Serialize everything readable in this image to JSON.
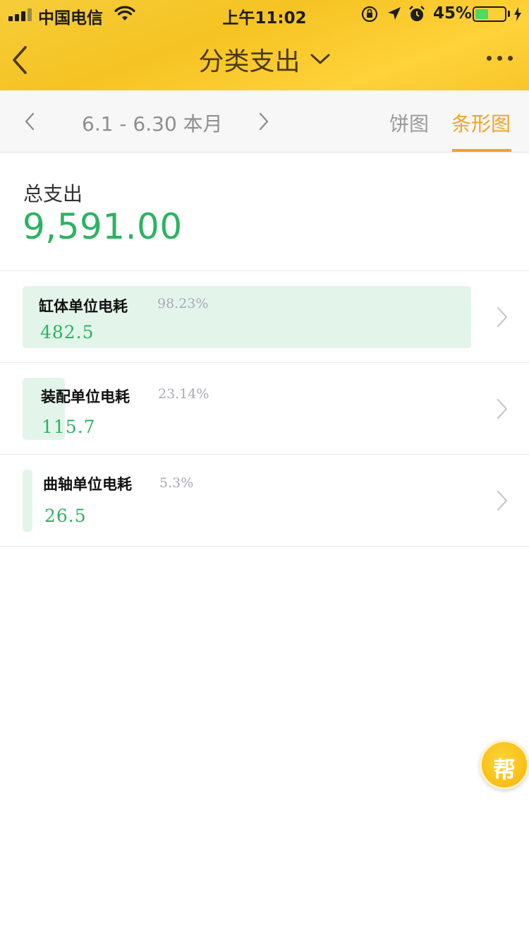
{
  "status_bar": {
    "carrier": "中国电信",
    "time": "上午11:02",
    "battery_percent": "45%",
    "battery_level": 0.45,
    "icons": [
      "signal-icon",
      "wifi-icon",
      "orientation-lock-icon",
      "location-icon",
      "alarm-icon",
      "battery-icon",
      "charging-icon"
    ]
  },
  "nav": {
    "title": "分类支出",
    "back_icon": "chevron-left-icon",
    "dropdown_icon": "chevron-down-icon",
    "more_icon": "more-dots-icon"
  },
  "period": {
    "label": "6.1 - 6.30 本月",
    "prev_icon": "chevron-left-icon",
    "next_icon": "chevron-right-icon"
  },
  "tabs": [
    {
      "label": "饼图",
      "active": false
    },
    {
      "label": "条形图",
      "active": true
    }
  ],
  "summary": {
    "label": "总支出",
    "total": "9,591.00"
  },
  "categories": [
    {
      "name": "缸体单位电耗",
      "percent": "98.23%",
      "value": "482.5",
      "share": 0.9823
    },
    {
      "name": "装配单位电耗",
      "percent": "23.14%",
      "value": "115.7",
      "share": 0.2314
    },
    {
      "name": "曲轴单位电耗",
      "percent": "5.3%",
      "value": "26.5",
      "share": 0.053
    }
  ],
  "help_button": {
    "label": "帮"
  },
  "colors": {
    "header_yellow": "#f6c82c",
    "accent_orange": "#f0a52a",
    "value_green": "#2bb361",
    "bar_green": "#e3f5ea"
  }
}
